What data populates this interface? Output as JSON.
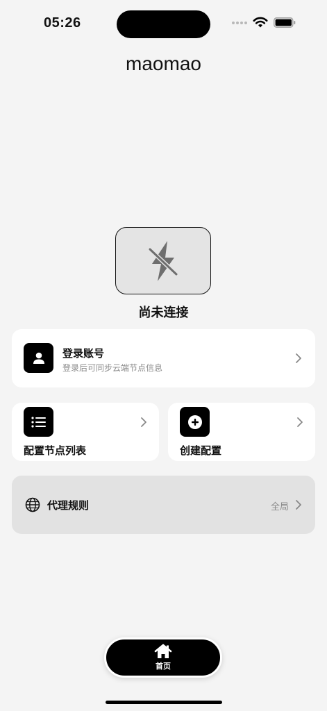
{
  "status_bar": {
    "time": "05:26"
  },
  "app": {
    "title": "maomao"
  },
  "connection": {
    "status": "尚未连接",
    "icon": "bolt-slash-icon"
  },
  "account_card": {
    "title": "登录账号",
    "subtitle": "登录后可同步云端节点信息",
    "icon": "person-icon"
  },
  "node_list_card": {
    "title": "配置节点列表",
    "icon": "list-icon"
  },
  "create_config_card": {
    "title": "创建配置",
    "icon": "plus-circle-icon"
  },
  "proxy_rules": {
    "title": "代理规则",
    "value": "全局",
    "icon": "globe-icon"
  },
  "tab_bar": {
    "home_label": "首页",
    "icon": "home-icon"
  }
}
